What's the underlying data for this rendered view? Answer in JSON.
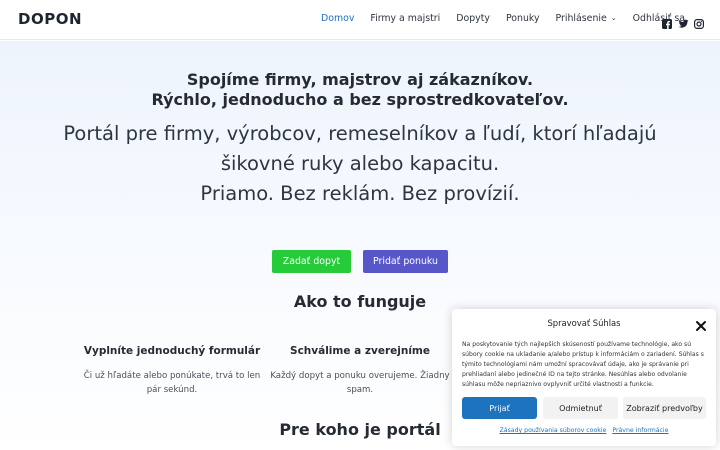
{
  "header": {
    "logo": "DOPON",
    "nav": [
      {
        "label": "Domov"
      },
      {
        "label": "Firmy a majstri"
      },
      {
        "label": "Dopyty"
      },
      {
        "label": "Ponuky"
      },
      {
        "label": "Prihlásenie"
      },
      {
        "label": "Odhlásiť sa"
      }
    ],
    "social_icons": [
      "facebook-icon",
      "twitter-icon",
      "instagram-icon"
    ]
  },
  "hero": {
    "title_line1": "Spojíme firmy, majstrov aj zákazníkov.",
    "title_line2": "Rýchlo, jednoducho a bez sprostredkovateľov.",
    "lead_line1": "Portál pre firmy, výrobcov, remeselníkov a ľudí, ktorí hľadajú",
    "lead_line2": "šikovné ruky alebo kapacitu.",
    "lead_line3": "Priamo. Bez reklám. Bez provízií.",
    "btn_request": "Zadať dopyt",
    "btn_offer": "Pridať ponuku"
  },
  "how": {
    "title": "Ako to funguje",
    "steps": [
      {
        "title": "Vyplníte jednoduchý formulár",
        "text_line1": "Či už hľadáte alebo ponúkate, trvá to len",
        "text_line2": "pár sekúnd."
      },
      {
        "title": "Schválime a zverejníme",
        "text_line1": "Každý dopyt a ponuku overujeme. Žiadny",
        "text_line2": "spam."
      }
    ]
  },
  "who": {
    "title": "Pre koho je portál"
  },
  "cookie": {
    "title": "Spravovať Súhlas",
    "text": "Na poskytovanie tých najlepších skúseností používame technológie, ako sú súbory cookie na ukladanie a/alebo prístup k informáciám o zariadení. Súhlas s týmito technológiami nám umožní spracovávať údaje, ako je správanie pri prehliadaní alebo jedinečné ID na tejto stránke. Nesúhlas alebo odvolanie súhlasu môže nepriaznivo ovplyvniť určité vlastnosti a funkcie.",
    "accept": "Prijať",
    "deny": "Odmietnuť",
    "prefs": "Zobraziť predvoľby",
    "link1": "Zásady používania súborov cookie",
    "link2": "Právne informácie"
  },
  "colors": {
    "accent": "#1f6fbf",
    "btn_green": "#26cb3a",
    "btn_blue": "#5757c9",
    "cookie_accept": "#1e73be"
  }
}
